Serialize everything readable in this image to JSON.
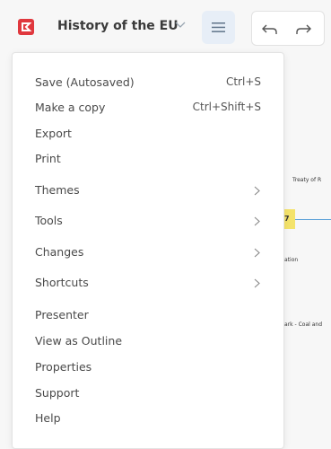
{
  "toolbar": {
    "title": "History of the EU",
    "menu_icon": "hamburger-icon",
    "undo_icon": "undo-icon",
    "redo_icon": "redo-icon",
    "accent": "#e0383e"
  },
  "canvas": {
    "snippet_1": "Treaty of R",
    "snippet_2": "7",
    "snippet_3": "ation",
    "snippet_4": "ark - Coal and"
  },
  "menu": {
    "items": [
      {
        "label": "Save (Autosaved)",
        "shortcut": "Ctrl+S"
      },
      {
        "label": "Make a copy",
        "shortcut": "Ctrl+Shift+S"
      },
      {
        "label": "Export"
      },
      {
        "label": "Print"
      },
      {
        "label": "Themes",
        "submenu": true
      },
      {
        "label": "Tools",
        "submenu": true
      },
      {
        "label": "Changes",
        "submenu": true
      },
      {
        "label": "Shortcuts",
        "submenu": true
      },
      {
        "label": "Presenter"
      },
      {
        "label": "View as Outline"
      },
      {
        "label": "Properties"
      },
      {
        "label": "Support"
      },
      {
        "label": "Help"
      }
    ]
  }
}
